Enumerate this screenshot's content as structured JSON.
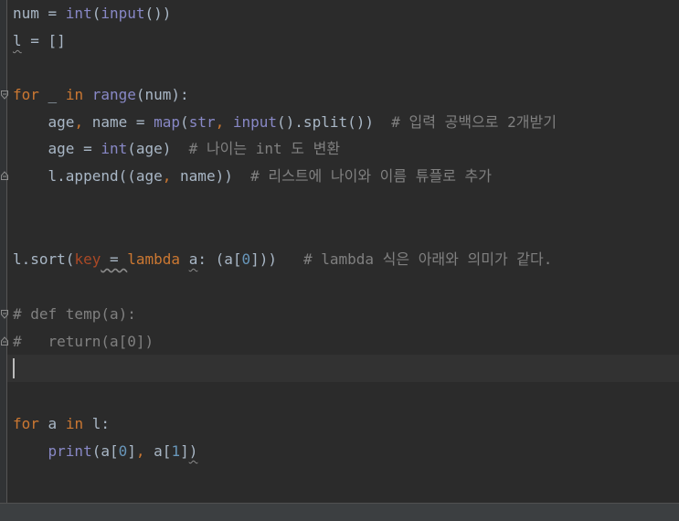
{
  "lines": {
    "l1": {
      "a": "num = ",
      "b": "int",
      "c": "(",
      "d": "input",
      "e": "())"
    },
    "l2": {
      "a": "l",
      "b": " = []"
    },
    "l4": {
      "a": "for",
      "b": " _ ",
      "c": "in",
      "d": " ",
      "e": "range",
      "f": "(num):"
    },
    "l5": {
      "a": "    age",
      "b": ",",
      "c": " name = ",
      "d": "map",
      "e": "(",
      "f": "str",
      "g": ", ",
      "h": "input",
      "i": "().split())  ",
      "j": "# 입력 공백으로 2개받기"
    },
    "l6": {
      "a": "    age = ",
      "b": "int",
      "c": "(age)  ",
      "d": "# 나이는 int 도 변환"
    },
    "l7": {
      "a": "    l.append((age",
      "b": ",",
      "c": " name))  ",
      "d": "# 리스트에 나이와 이름 튜플로 추가"
    },
    "l10": {
      "a": "l.sort(",
      "b": "key",
      "c": " = ",
      "d": "lambda",
      "e": " ",
      "f": "a",
      "g": ": (a[",
      "h": "0",
      "i": "]))   ",
      "j": "# lambda 식은 아래와 의미가 같다."
    },
    "l12": {
      "a": "# def temp(a):"
    },
    "l13": {
      "a": "#   return(a[0])"
    },
    "l16": {
      "a": "for",
      "b": " a ",
      "c": "in",
      "d": " l:"
    },
    "l17": {
      "a": "    ",
      "b": "print",
      "c": "(a[",
      "d": "0",
      "e": "]",
      "f": ",",
      "g": " a[",
      "h": "1",
      "i": "]",
      "j": ")"
    }
  },
  "colors": {
    "background": "#2b2b2b",
    "keyword": "#cc7832",
    "builtin": "#8888c6",
    "number": "#6897bb",
    "comment": "#808080",
    "text": "#a9b7c6",
    "parameter": "#aa4926"
  },
  "icons": {
    "fold_open": "fold-open-icon",
    "fold_close": "fold-close-icon"
  }
}
